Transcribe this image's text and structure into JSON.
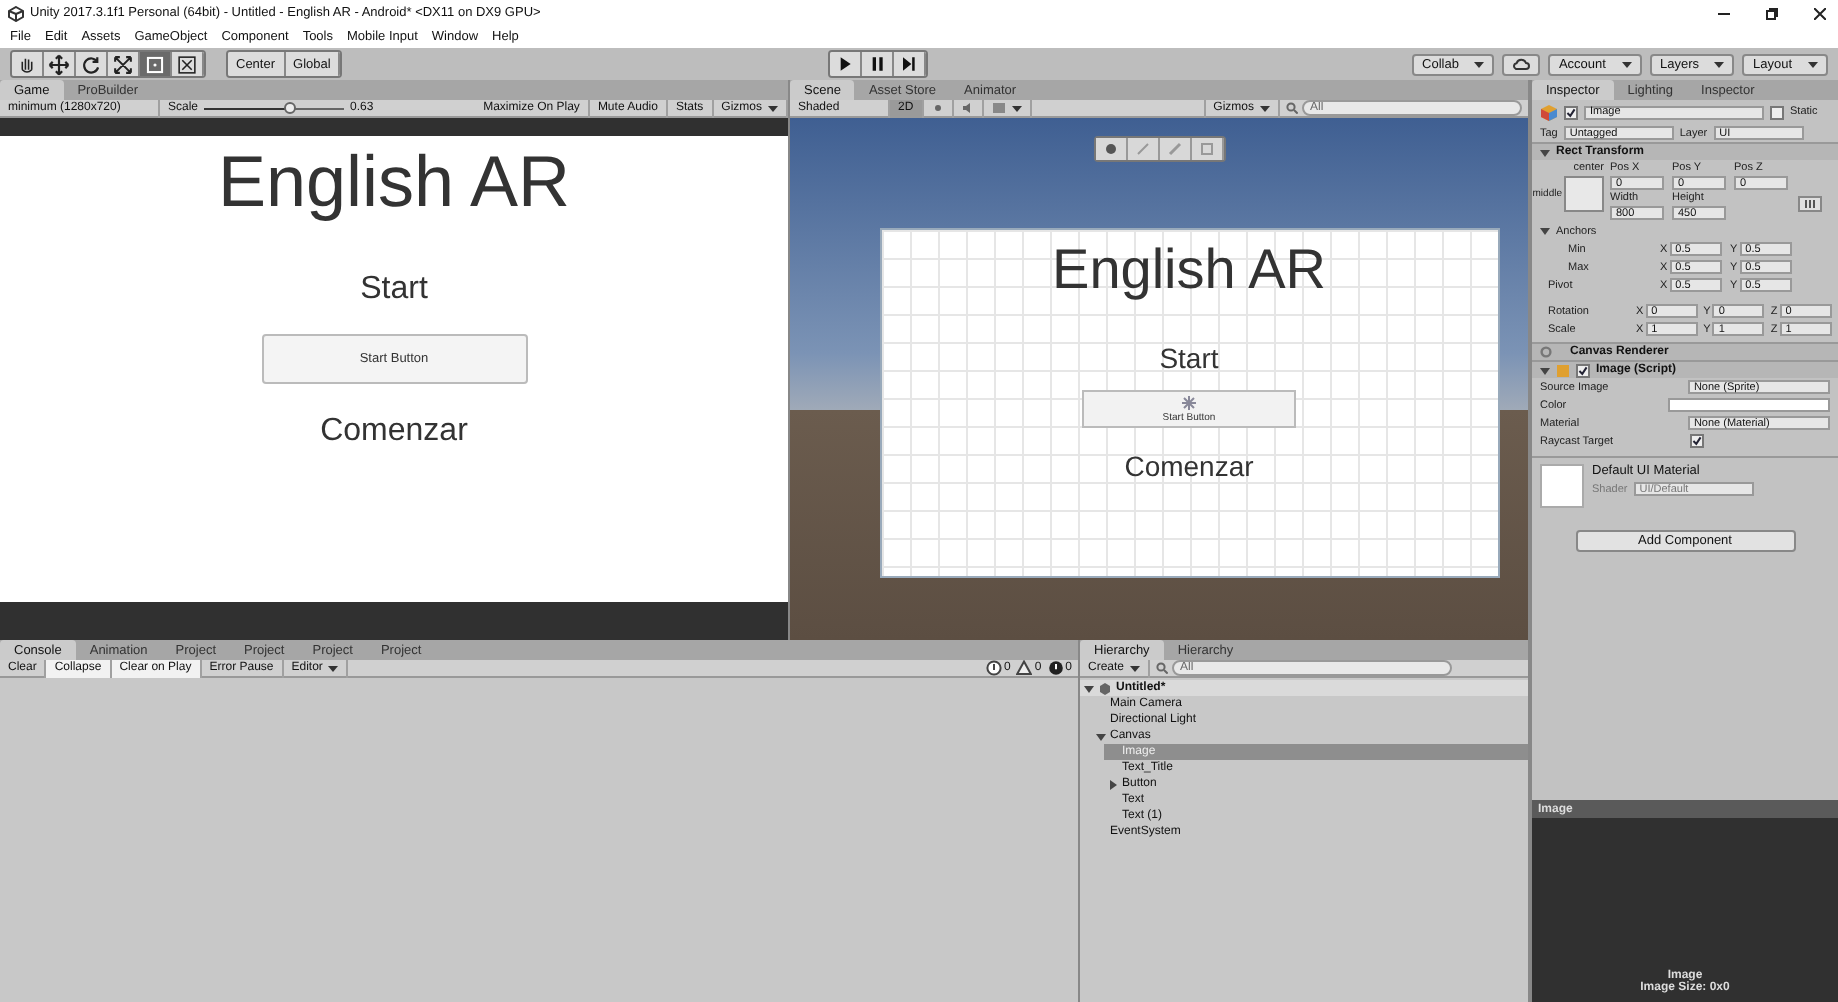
{
  "window": {
    "title": "Unity 2017.3.1f1 Personal (64bit) - Untitled - English AR - Android* <DX11 on DX9 GPU>"
  },
  "menu": [
    "File",
    "Edit",
    "Assets",
    "GameObject",
    "Component",
    "Tools",
    "Mobile Input",
    "Window",
    "Help"
  ],
  "toolbar": {
    "tools": [
      {
        "kind": "hand",
        "selected": false
      },
      {
        "kind": "move",
        "selected": false
      },
      {
        "kind": "rotate",
        "selected": false
      },
      {
        "kind": "scale",
        "selected": false
      },
      {
        "kind": "rect",
        "selected": true
      },
      {
        "kind": "transform",
        "selected": false
      }
    ],
    "pivot": [
      "Center",
      "Global"
    ],
    "playback": [
      {
        "kind": "play",
        "selected": false
      },
      {
        "kind": "pause",
        "selected": false
      },
      {
        "kind": "step",
        "selected": false
      }
    ],
    "right": [
      {
        "label": "Collab",
        "caret": true
      },
      {
        "label": "Account",
        "caret": true
      },
      {
        "label": "Layers",
        "caret": true
      },
      {
        "label": "Layout",
        "caret": true
      }
    ]
  },
  "game": {
    "tabs": [
      {
        "label": "Game",
        "selected": true
      },
      {
        "label": "ProBuilder",
        "selected": false
      }
    ],
    "resolution": "minimum (1280x720)",
    "scale_label": "Scale",
    "scale": {
      "level": 0.62
    },
    "scale_reading": "0.63",
    "options": [
      {
        "label": "Maximize On Play",
        "caret": false
      },
      {
        "label": "Mute Audio",
        "caret": false
      },
      {
        "label": "Stats",
        "caret": false
      },
      {
        "label": "Gizmos",
        "caret": true
      }
    ],
    "view": {
      "title": "English AR",
      "heading": "Start",
      "button": "Start Button",
      "subtitle": "Comenzar"
    }
  },
  "scene": {
    "tabs": [
      {
        "label": "Scene",
        "selected": true
      },
      {
        "label": "Asset Store",
        "selected": false
      },
      {
        "label": "Animator",
        "selected": false
      }
    ],
    "shading": "Shaded",
    "mode_2d": {
      "label": "2D",
      "selected": true
    },
    "lighting": {
      "on": false
    },
    "audio": {
      "on": false
    },
    "gizmos": "Gizmos",
    "search": {
      "placeholder": "All"
    },
    "view": {
      "title": "English AR",
      "heading": "Start",
      "button": "Start Button",
      "subtitle": "Comenzar"
    }
  },
  "inspector": {
    "tabs": [
      {
        "label": "Inspector",
        "selected": true
      },
      {
        "label": "Lighting",
        "selected": false
      },
      {
        "label": "Inspector",
        "selected": false
      }
    ],
    "object": {
      "active": true,
      "name": "Image",
      "static_label": "Static",
      "static": false
    },
    "tag_label": "Tag",
    "tag": "Untagged",
    "layer_label": "Layer",
    "layer": "UI",
    "rect_transform": {
      "title": "Rect Transform",
      "expanded": true,
      "anchor_h": "center",
      "anchor_v": "middle",
      "fields": [
        {
          "label": "Pos X",
          "value": "0"
        },
        {
          "label": "Pos Y",
          "value": "0"
        },
        {
          "label": "Pos Z",
          "value": "0"
        },
        {
          "label": "Width",
          "value": "800"
        },
        {
          "label": "Height",
          "value": "450"
        }
      ],
      "anchors": {
        "title": "Anchors",
        "expanded": true,
        "rows": [
          {
            "label": "Min",
            "values": [
              {
                "axis": "X",
                "value": "0.5"
              },
              {
                "axis": "Y",
                "value": "0.5"
              }
            ]
          },
          {
            "label": "Max",
            "values": [
              {
                "axis": "X",
                "value": "0.5"
              },
              {
                "axis": "Y",
                "value": "0.5"
              }
            ]
          }
        ]
      },
      "vectors": [
        {
          "label": "Pivot",
          "values": [
            {
              "axis": "X",
              "value": "0.5"
            },
            {
              "axis": "Y",
              "value": "0.5"
            }
          ]
        },
        {
          "label": "Rotation",
          "values": [
            {
              "axis": "X",
              "value": "0"
            },
            {
              "axis": "Y",
              "value": "0"
            },
            {
              "axis": "Z",
              "value": "0"
            }
          ]
        },
        {
          "label": "Scale",
          "values": [
            {
              "axis": "X",
              "value": "1"
            },
            {
              "axis": "Y",
              "value": "1"
            },
            {
              "axis": "Z",
              "value": "1"
            }
          ]
        }
      ]
    },
    "canvas_renderer": {
      "title": "Canvas Renderer"
    },
    "image_script": {
      "title": "Image (Script)",
      "enabled": true,
      "expanded": true,
      "props": [
        {
          "kind": "text",
          "label": "Source Image",
          "value": "None (Sprite)"
        },
        {
          "kind": "color",
          "label": "Color",
          "color": "#ffffff"
        },
        {
          "kind": "text",
          "label": "Material",
          "value": "None (Material)"
        },
        {
          "kind": "check",
          "label": "Raycast Target",
          "checked": true
        }
      ]
    },
    "material": {
      "name": "Default UI Material",
      "shader_label": "Shader",
      "shader": "UI/Default"
    },
    "add_component": "Add Component"
  },
  "console": {
    "tabs": [
      {
        "label": "Console",
        "selected": true
      },
      {
        "label": "Animation",
        "selected": false
      },
      {
        "label": "Project",
        "selected": false
      },
      {
        "label": "Project",
        "selected": false
      },
      {
        "label": "Project",
        "selected": false
      },
      {
        "label": "Project",
        "selected": false
      }
    ],
    "buttons": [
      {
        "label": "Clear",
        "on": false,
        "caret": false
      },
      {
        "label": "Collapse",
        "on": true,
        "caret": false
      },
      {
        "label": "Clear on Play",
        "on": true,
        "caret": false
      },
      {
        "label": "Error Pause",
        "on": false,
        "caret": false
      },
      {
        "label": "Editor",
        "on": false,
        "caret": true
      }
    ],
    "counts": [
      {
        "kind": "info",
        "count": "0"
      },
      {
        "kind": "warning",
        "count": "0"
      },
      {
        "kind": "error",
        "count": "0"
      }
    ]
  },
  "hierarchy": {
    "tabs": [
      {
        "label": "Hierarchy",
        "selected": true
      },
      {
        "label": "Hierarchy",
        "selected": false
      }
    ],
    "create": "Create",
    "search": {
      "placeholder": "All"
    },
    "tree": {
      "label": "Untitled*",
      "expanded": true,
      "selected": false,
      "children": [
        {
          "label": "Main Camera",
          "selected": false
        },
        {
          "label": "Directional Light",
          "selected": false
        },
        {
          "label": "Canvas",
          "expanded": true,
          "selected": false,
          "children": [
            {
              "label": "Image",
              "selected": true
            },
            {
              "label": "Text_Title",
              "selected": false
            },
            {
              "label": "Button",
              "expanded": false,
              "selected": false
            },
            {
              "label": "Text",
              "selected": false
            },
            {
              "label": "Text (1)",
              "selected": false
            }
          ]
        },
        {
          "label": "EventSystem",
          "selected": false
        }
      ]
    }
  },
  "preview": {
    "title": "Image",
    "name": "Image",
    "size": "Image Size: 0x0"
  }
}
